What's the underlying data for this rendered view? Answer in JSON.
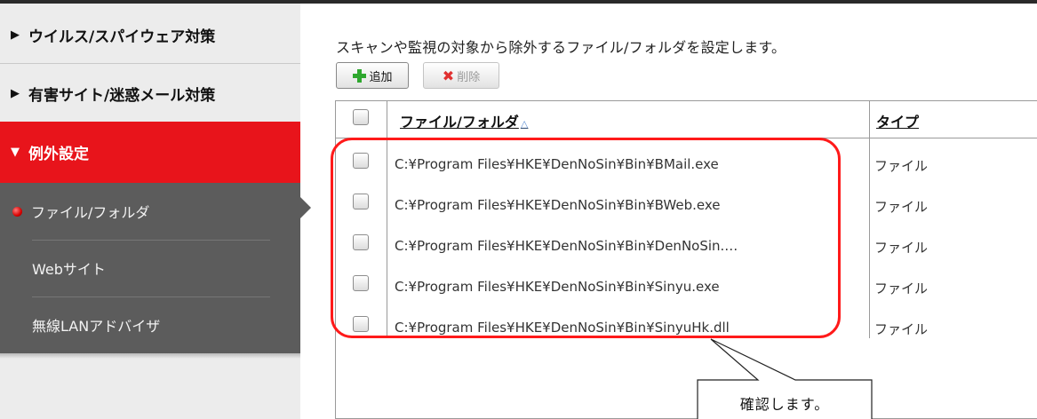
{
  "sidebar": {
    "items": [
      {
        "label": "ウイルス/スパイウェア対策"
      },
      {
        "label": "有害サイト/迷惑メール対策"
      },
      {
        "label": "例外設定"
      }
    ],
    "submenu": [
      {
        "label": "ファイル/フォルダ"
      },
      {
        "label": "Webサイト"
      },
      {
        "label": "無線LANアドバイザ"
      }
    ]
  },
  "main": {
    "description": "スキャンや監視の対象から除外するファイル/フォルダを設定します。",
    "toolbar": {
      "add_label": "追加",
      "delete_label": "削除"
    },
    "table": {
      "columns": [
        "ファイル/フォルダ",
        "タイプ"
      ],
      "rows": [
        {
          "path": "C:¥Program Files¥HKE¥DenNoSin¥Bin¥BMail.exe",
          "type": "ファイル"
        },
        {
          "path": "C:¥Program Files¥HKE¥DenNoSin¥Bin¥BWeb.exe",
          "type": "ファイル"
        },
        {
          "path": "C:¥Program Files¥HKE¥DenNoSin¥Bin¥DenNoSin.…",
          "type": "ファイル"
        },
        {
          "path": "C:¥Program Files¥HKE¥DenNoSin¥Bin¥Sinyu.exe",
          "type": "ファイル"
        },
        {
          "path": "C:¥Program Files¥HKE¥DenNoSin¥Bin¥SinyuHk.dll",
          "type": "ファイル"
        }
      ]
    }
  },
  "annotation": {
    "callout_text": "確認します。"
  },
  "colors": {
    "accent": "#e8141b",
    "submenu_bg": "#5c5c5c",
    "highlight": "#ff1a1a"
  },
  "icons": {
    "add": "plus-icon",
    "delete": "x-icon",
    "sort": "sort-ascending-icon",
    "selected": "red-dot-icon"
  }
}
